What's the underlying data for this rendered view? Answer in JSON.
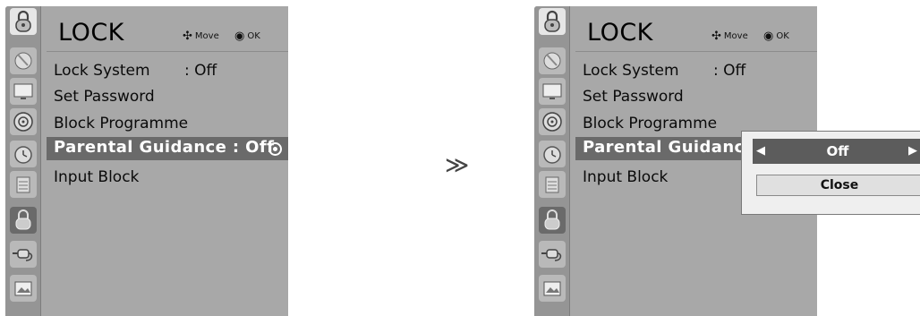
{
  "left_menu": {
    "title": "LOCK",
    "hint_move": "Move",
    "hint_ok": "OK",
    "items": [
      {
        "label": "Lock System",
        "value": ": Off"
      },
      {
        "label": "Set Password",
        "value": ""
      },
      {
        "label": "Block Programme",
        "value": ""
      },
      {
        "label": "Parental Guidance : Off",
        "value": ""
      },
      {
        "label": "Input Block",
        "value": ""
      }
    ]
  },
  "transition_symbol": "≫",
  "right_menu": {
    "title": "LOCK",
    "hint_move": "Move",
    "hint_ok": "OK",
    "items": [
      {
        "label": "Lock System",
        "value": ": Off"
      },
      {
        "label": "Set Password",
        "value": ""
      },
      {
        "label": "Block Programme",
        "value": ""
      },
      {
        "label": "Parental Guidance :",
        "value": ""
      },
      {
        "label": "Input Block",
        "value": ""
      }
    ],
    "popup": {
      "left_arrow": "◀",
      "value": "Off",
      "right_arrow": "▶",
      "close_label": "Close"
    }
  },
  "icons": [
    "lock-top-icon",
    "satellite-icon",
    "monitor-icon",
    "speaker-icon",
    "clock-icon",
    "option-icon",
    "lock-icon",
    "input-plug-icon",
    "usb-photo-icon"
  ]
}
